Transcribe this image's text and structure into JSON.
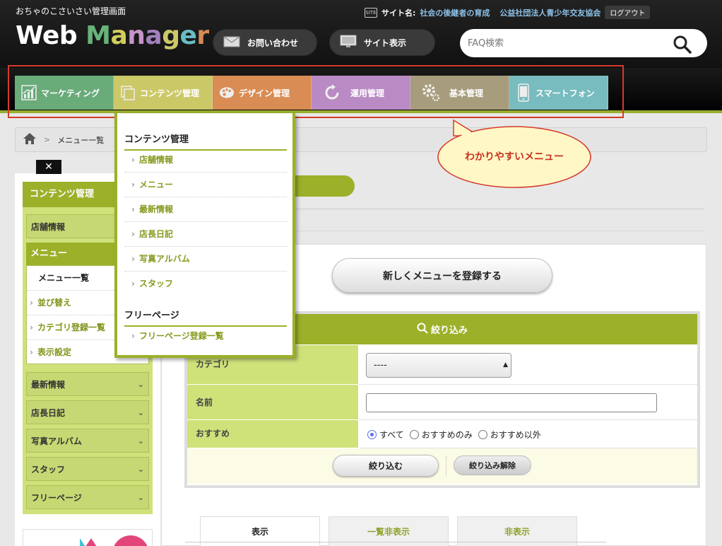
{
  "header": {
    "admin_title": "おちゃのこさいさい管理画面",
    "logo": {
      "part1": "Web ",
      "m": "M",
      "a": "a",
      "n": "n",
      "a2": "a",
      "g": "g",
      "e": "e",
      "r": "r"
    },
    "logo_colors": [
      "#67b37a",
      "#d1cd5d",
      "#c695c9",
      "#a27fbd",
      "#cbc868",
      "#69bcc2",
      "#d58b55"
    ],
    "contact_label": "お問い合わせ",
    "site_view_label": "サイト表示",
    "site_icon_text": "SITE",
    "site_label": "サイト名:",
    "site_name": "社会の後継者の育成",
    "org_name": "公益社団法人青少年交友協会",
    "logout_label": "ログアウト",
    "search_placeholder": "FAQ検索"
  },
  "nav": {
    "tabs": [
      {
        "label": "マーケティング",
        "icon": "chart-icon",
        "color": "#6aab7a"
      },
      {
        "label": "コンテンツ管理",
        "icon": "pages-icon",
        "color": "#cbc868"
      },
      {
        "label": "デザイン管理",
        "icon": "palette-icon",
        "color": "#d98c53"
      },
      {
        "label": "運用管理",
        "icon": "refresh-icon",
        "color": "#b98ac3"
      },
      {
        "label": "基本管理",
        "icon": "gear-icon",
        "color": "#a79c7c"
      },
      {
        "label": "スマートフォン",
        "icon": "phone-icon",
        "color": "#78bcbf"
      }
    ]
  },
  "breadcrumb": {
    "separator": ">",
    "current": "メニュー一覧"
  },
  "callout": {
    "text": "わかりやすいメニュー"
  },
  "sidebar": {
    "close_label": "✕",
    "heading": "コンテンツ管理",
    "store_info": "店舗情報",
    "menu_heading": "メニュー",
    "menu_items": [
      "メニュー一覧",
      "並び替え",
      "カテゴリ登録一覧",
      "表示設定"
    ],
    "categories": [
      "最新情報",
      "店長日記",
      "写真アルバム",
      "スタッフ",
      "フリーページ"
    ]
  },
  "dropdown": {
    "section1_title": "コンテンツ管理",
    "section1_items": [
      "店舗情報",
      "メニュー",
      "最新情報",
      "店長日記",
      "写真アルバム",
      "スタッフ"
    ],
    "section2_title": "フリーページ",
    "section2_items": [
      "フリーページ登録一覧"
    ]
  },
  "main": {
    "register_label": "新しくメニューを登録する",
    "filter": {
      "title": "絞り込み",
      "category_label": "カテゴリ",
      "category_value": "----",
      "name_label": "名前",
      "name_value": "",
      "recommend_label": "おすすめ",
      "radio_options": [
        "すべて",
        "おすすめのみ",
        "おすすめ以外"
      ],
      "radio_selected": "すべて",
      "apply_label": "絞り込む",
      "clear_label": "絞り込み解除"
    },
    "tabs": [
      "表示",
      "一覧非表示",
      "非表示"
    ]
  },
  "colors": {
    "accent_green": "#9db02a",
    "highlight_red": "#d63a2a",
    "light_green": "#cfe27a"
  }
}
